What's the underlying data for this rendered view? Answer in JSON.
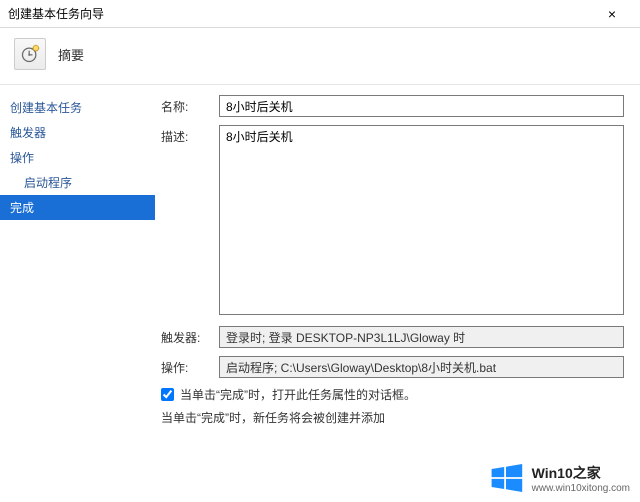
{
  "window": {
    "title": "创建基本任务向导",
    "close": "×"
  },
  "header": {
    "summary": "摘要"
  },
  "sidebar": {
    "items": [
      {
        "label": "创建基本任务"
      },
      {
        "label": "触发器"
      },
      {
        "label": "操作"
      },
      {
        "label": "启动程序"
      },
      {
        "label": "完成"
      }
    ]
  },
  "form": {
    "name_label": "名称:",
    "name_value": "8小时后关机",
    "desc_label": "描述:",
    "desc_value": "8小时后关机",
    "trigger_label": "触发器:",
    "trigger_value": "登录时; 登录 DESKTOP-NP3L1LJ\\Gloway 时",
    "action_label": "操作:",
    "action_value": "启动程序; C:\\Users\\Gloway\\Desktop\\8小时关机.bat",
    "checkbox_label": "当单击“完成”时，打开此任务属性的对话框。",
    "info_text": "当单击“完成”时，新任务将会被创建并添加"
  },
  "watermark": {
    "brand": "Win10之家",
    "url": "www.win10xitong.com"
  }
}
